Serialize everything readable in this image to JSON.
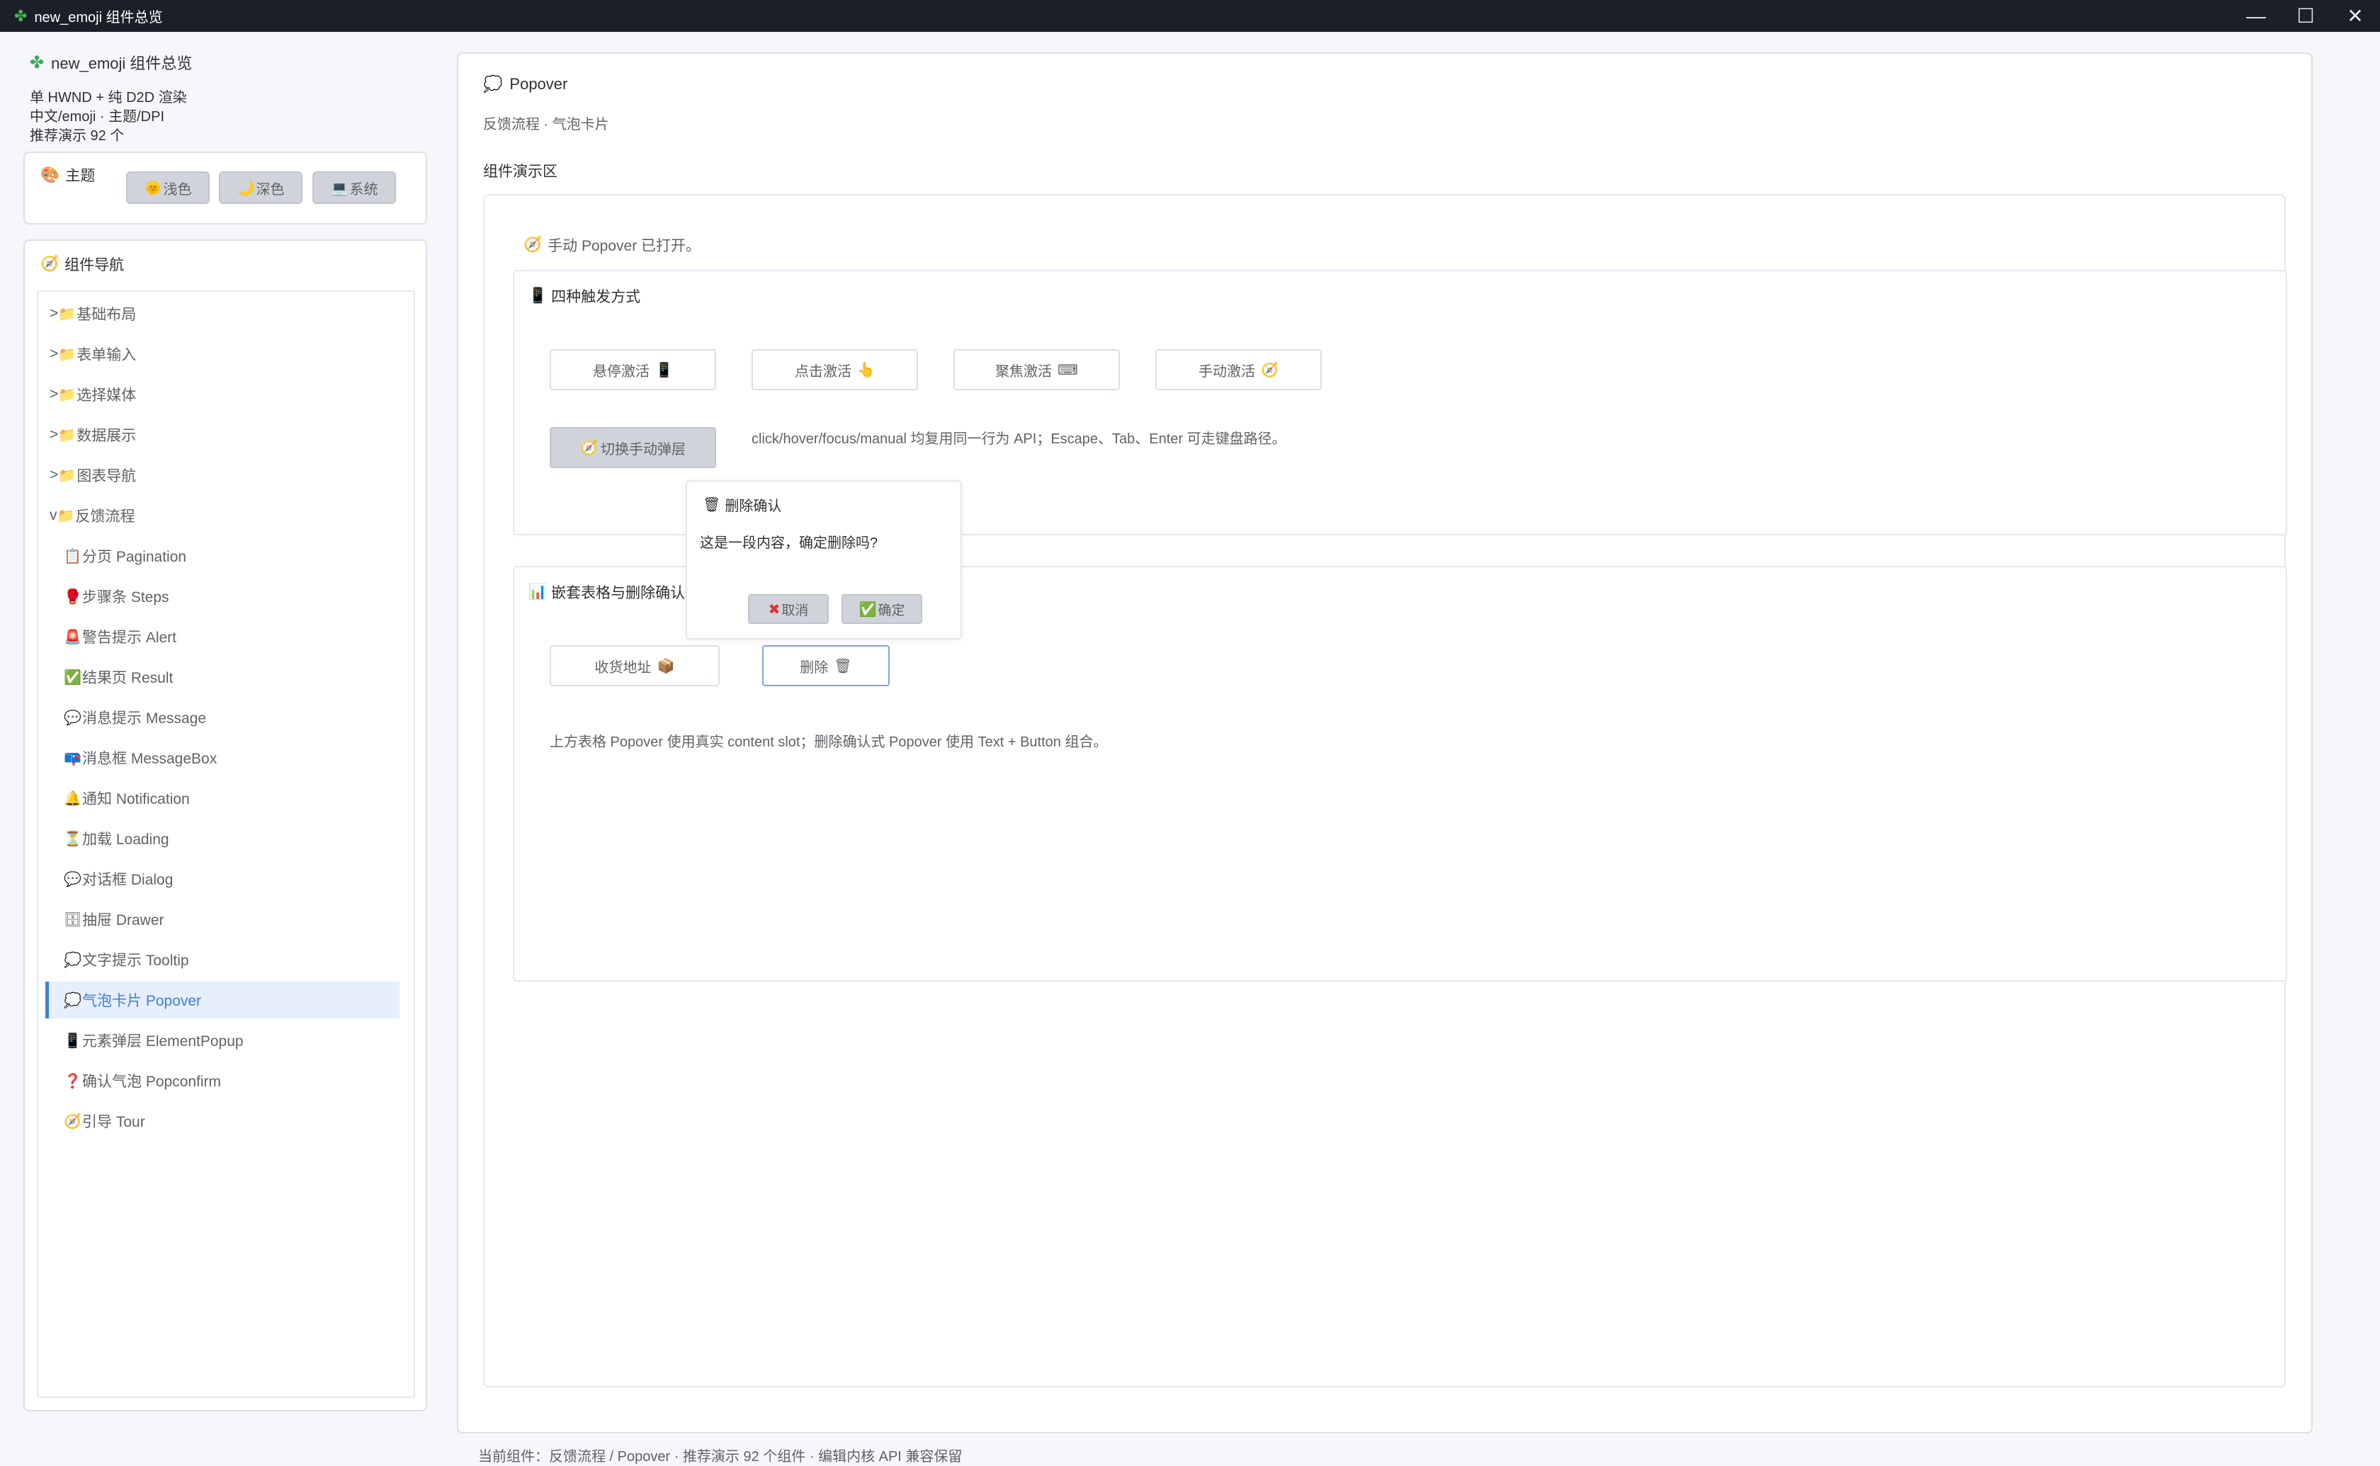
{
  "window": {
    "title": "new_emoji 组件总览",
    "minimize": "—",
    "maximize": "☐",
    "close": "✕"
  },
  "sidebar": {
    "brand": "new_emoji 组件总览",
    "info": [
      "单 HWND + 纯 D2D 渲染",
      "中文/emoji · 主题/DPI",
      "推荐演示 92 个"
    ],
    "theme": {
      "title": "主题",
      "light": "浅色",
      "dark": "深色",
      "system": "系统"
    },
    "nav_title": "组件导航",
    "groups": [
      {
        "arrow": ">",
        "label": "基础布局"
      },
      {
        "arrow": ">",
        "label": "表单输入"
      },
      {
        "arrow": ">",
        "label": "选择媒体"
      },
      {
        "arrow": ">",
        "label": "数据展示"
      },
      {
        "arrow": ">",
        "label": "图表导航"
      },
      {
        "arrow": "v",
        "label": "反馈流程"
      }
    ],
    "children": [
      {
        "icon": "📋",
        "label": "分页 Pagination"
      },
      {
        "icon": "🥊",
        "label": "步骤条 Steps"
      },
      {
        "icon": "🚨",
        "label": "警告提示 Alert"
      },
      {
        "icon": "✅",
        "label": "结果页 Result"
      },
      {
        "icon": "💬",
        "label": "消息提示 Message"
      },
      {
        "icon": "📪",
        "label": "消息框 MessageBox"
      },
      {
        "icon": "🔔",
        "label": "通知 Notification"
      },
      {
        "icon": "⏳",
        "label": "加载 Loading"
      },
      {
        "icon": "💬",
        "label": "对话框 Dialog"
      },
      {
        "icon": "🗄",
        "label": "抽屉 Drawer"
      },
      {
        "icon": "💭",
        "label": "文字提示 Tooltip"
      },
      {
        "icon": "💭",
        "label": "气泡卡片 Popover"
      },
      {
        "icon": "📱",
        "label": "元素弹层 ElementPopup"
      },
      {
        "icon": "❓",
        "label": "确认气泡 Popconfirm"
      },
      {
        "icon": "🧭",
        "label": "引导 Tour"
      }
    ]
  },
  "main": {
    "title": "Popover",
    "breadcrumb": "反馈流程 · 气泡卡片",
    "section_label": "组件演示区",
    "status": "手动 Popover 已打开。",
    "card1": {
      "title": "四种触发方式",
      "hover_btn": "悬停激活",
      "click_btn": "点击激活",
      "focus_btn": "聚焦激活",
      "manual_btn": "手动激活",
      "toggle_btn": "切换手动弹层",
      "desc": "click/hover/focus/manual 均复用同一行为 API；Escape、Tab、Enter 可走键盘路径。"
    },
    "card2": {
      "title": "嵌套表格与删除确认",
      "address_btn": "收货地址",
      "delete_btn": "删除",
      "desc": "上方表格 Popover 使用真实 content slot；删除确认式 Popover 使用 Text + Button 组合。"
    },
    "popover": {
      "title": "删除确认",
      "body": "这是一段内容，确定删除吗?",
      "cancel": "取消",
      "confirm": "确定"
    }
  },
  "footer": "当前组件：反馈流程 / Popover · 推荐演示 92 个组件 · 编辑内核 API 兼容保留",
  "colors": {
    "titlebar": "#1b1f27",
    "accent": "#3f7fd8",
    "active_bg": "#e6effc"
  }
}
